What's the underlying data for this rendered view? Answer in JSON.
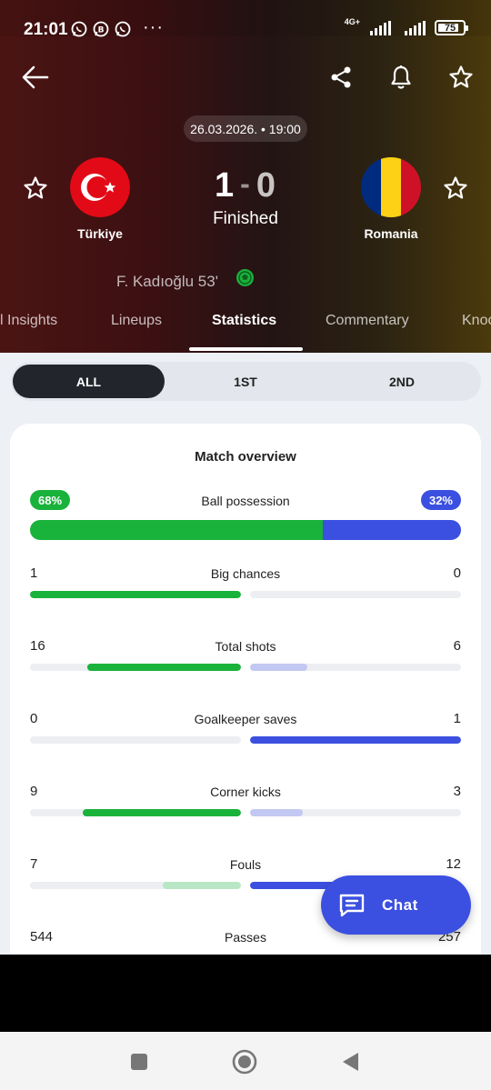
{
  "status_bar": {
    "time": "21:01",
    "app_icons": [
      "whatsapp-icon",
      "whatsapp-business-icon",
      "whatsapp-icon"
    ],
    "more": "···",
    "network": "4G+",
    "battery": "75"
  },
  "header": {
    "datetime": "26.03.2026. • 19:00",
    "home_team": "Türkiye",
    "away_team": "Romania",
    "home_score": "1",
    "away_score": "0",
    "separator": "-",
    "status": "Finished",
    "scorer": "F. Kadıoğlu 53'"
  },
  "tabs": [
    {
      "label": "l Insights"
    },
    {
      "label": "Lineups"
    },
    {
      "label": "Statistics"
    },
    {
      "label": "Commentary"
    },
    {
      "label": "Knoc"
    }
  ],
  "periods": [
    {
      "label": "ALL"
    },
    {
      "label": "1ST"
    },
    {
      "label": "2ND"
    }
  ],
  "overview": {
    "title": "Match overview",
    "possession": {
      "label": "Ball possession",
      "home": "68%",
      "away": "32%",
      "home_share": 68
    },
    "stats": [
      {
        "label": "Big chances",
        "home": "1",
        "away": "0",
        "home_fill": 1.0,
        "away_fill": 0.0
      },
      {
        "label": "Total shots",
        "home": "16",
        "away": "6",
        "home_fill": 0.73,
        "away_fill": 0.27
      },
      {
        "label": "Goalkeeper saves",
        "home": "0",
        "away": "1",
        "home_fill": 0.0,
        "away_fill": 1.0
      },
      {
        "label": "Corner kicks",
        "home": "9",
        "away": "3",
        "home_fill": 0.75,
        "away_fill": 0.25
      },
      {
        "label": "Fouls",
        "home": "7",
        "away": "12",
        "home_fill": 0.37,
        "away_fill": 0.63
      },
      {
        "label": "Passes",
        "home": "544",
        "away": "257",
        "home_fill": 0.68,
        "away_fill": 0.32
      }
    ]
  },
  "chat": {
    "label": "Chat"
  },
  "colors": {
    "home": "#19b23b",
    "away": "#3b50e0",
    "away_light": "#c3c8f2",
    "home_light": "#b9e6c4"
  }
}
